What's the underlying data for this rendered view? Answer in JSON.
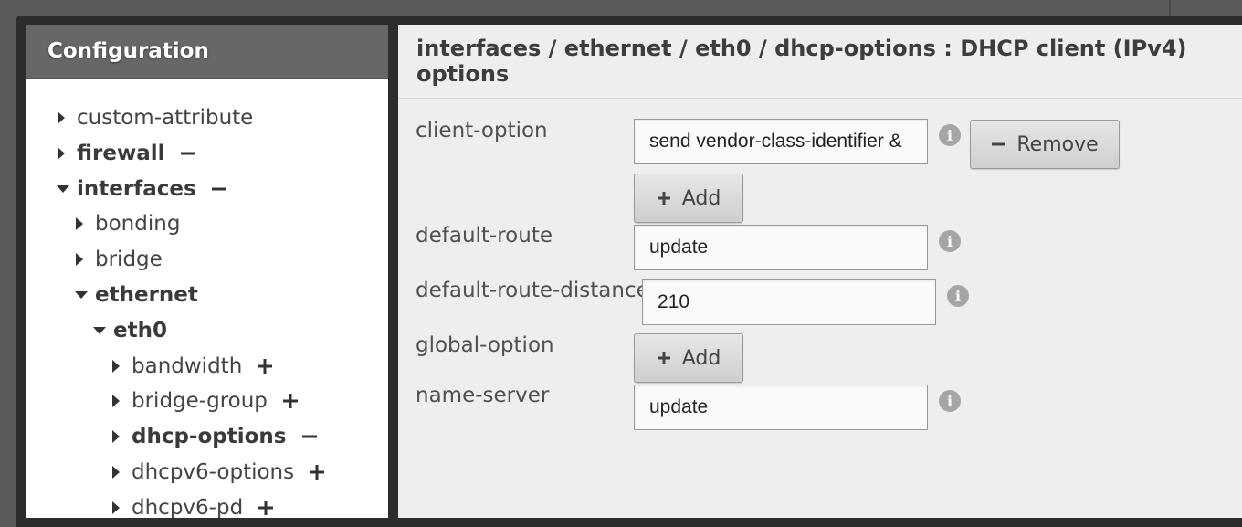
{
  "sidebar": {
    "title": "Configuration",
    "tree": [
      {
        "label": "custom-attribute",
        "state": "collapsed",
        "bold": false,
        "action": ""
      },
      {
        "label": "firewall",
        "state": "collapsed",
        "bold": true,
        "action": "minus"
      },
      {
        "label": "interfaces",
        "state": "expanded",
        "bold": true,
        "action": "minus"
      },
      {
        "label": "bonding",
        "state": "collapsed",
        "bold": false,
        "action": ""
      },
      {
        "label": "bridge",
        "state": "collapsed",
        "bold": false,
        "action": ""
      },
      {
        "label": "ethernet",
        "state": "expanded",
        "bold": true,
        "action": ""
      },
      {
        "label": "eth0",
        "state": "expanded",
        "bold": true,
        "action": ""
      },
      {
        "label": "bandwidth",
        "state": "collapsed",
        "bold": false,
        "action": "plus"
      },
      {
        "label": "bridge-group",
        "state": "collapsed",
        "bold": false,
        "action": "plus"
      },
      {
        "label": "dhcp-options",
        "state": "collapsed",
        "bold": true,
        "action": "minus"
      },
      {
        "label": "dhcpv6-options",
        "state": "collapsed",
        "bold": false,
        "action": "plus"
      },
      {
        "label": "dhcpv6-pd",
        "state": "collapsed",
        "bold": false,
        "action": "plus"
      }
    ]
  },
  "main": {
    "title": "interfaces / ethernet / eth0 / dhcp-options : DHCP client (IPv4) options",
    "fields": {
      "client_option": {
        "label": "client-option",
        "value": "send vendor-class-identifier &"
      },
      "default_route": {
        "label": "default-route",
        "value": "update"
      },
      "default_route_distance": {
        "label": "default-route-distance",
        "value": "210"
      },
      "global_option": {
        "label": "global-option"
      },
      "name_server": {
        "label": "name-server",
        "value": "update"
      }
    },
    "buttons": {
      "remove": "Remove",
      "add": "Add"
    },
    "info_glyph": "i"
  },
  "colors": {
    "header_bg": "#676767",
    "panel_bg": "#eeeeee",
    "frame": "#2d2d2d"
  }
}
